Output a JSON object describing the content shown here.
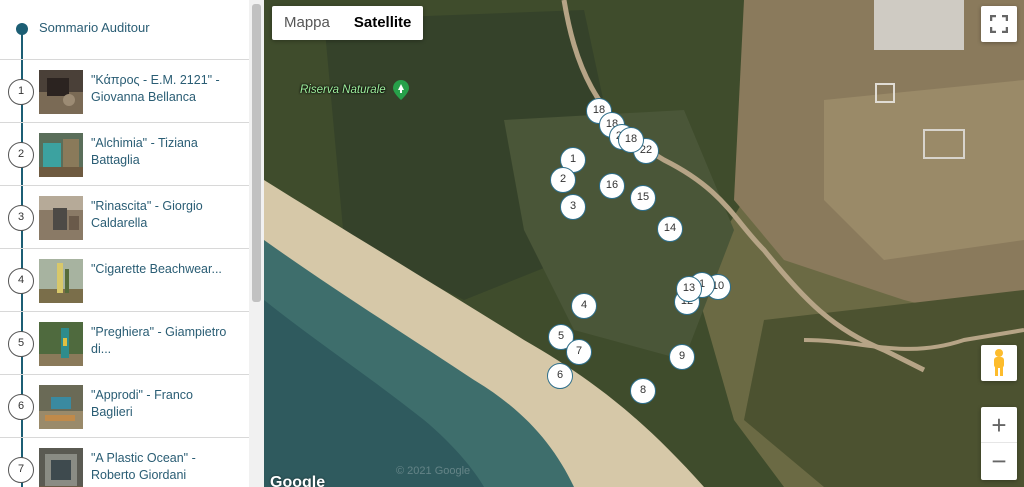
{
  "sidebar": {
    "summary_label": "Sommario Auditour",
    "items": [
      {
        "num": "1",
        "title": "\"Κάπρος - Ε.Μ. 2121\" - Giovanna Bellanca"
      },
      {
        "num": "2",
        "title": "\"Alchimia\" - Tiziana Battaglia"
      },
      {
        "num": "3",
        "title": "\"Rinascita\" - Giorgio Caldarella"
      },
      {
        "num": "4",
        "title": "\"Cigarette Beachwear..."
      },
      {
        "num": "5",
        "title": "\"Preghiera\" - Giampietro di..."
      },
      {
        "num": "6",
        "title": "\"Approdi\" - Franco Baglieri"
      },
      {
        "num": "7",
        "title": "\"A Plastic Ocean\" - Roberto Giordani"
      }
    ]
  },
  "map": {
    "type_buttons": {
      "map": "Mappa",
      "satellite": "Satellite"
    },
    "selected_type": "Satellite",
    "poi_label": "Riserva Naturale",
    "google_logo": "Google",
    "copyright": "© 2021 Google",
    "controls": {
      "zoom_in": "+",
      "zoom_out": "−"
    },
    "markers": [
      "1",
      "2",
      "3",
      "4",
      "5",
      "6",
      "7",
      "8",
      "9",
      "10",
      "12",
      "13",
      "14",
      "15",
      "16",
      "18",
      "22"
    ],
    "accent_color": "#1c5e74"
  }
}
